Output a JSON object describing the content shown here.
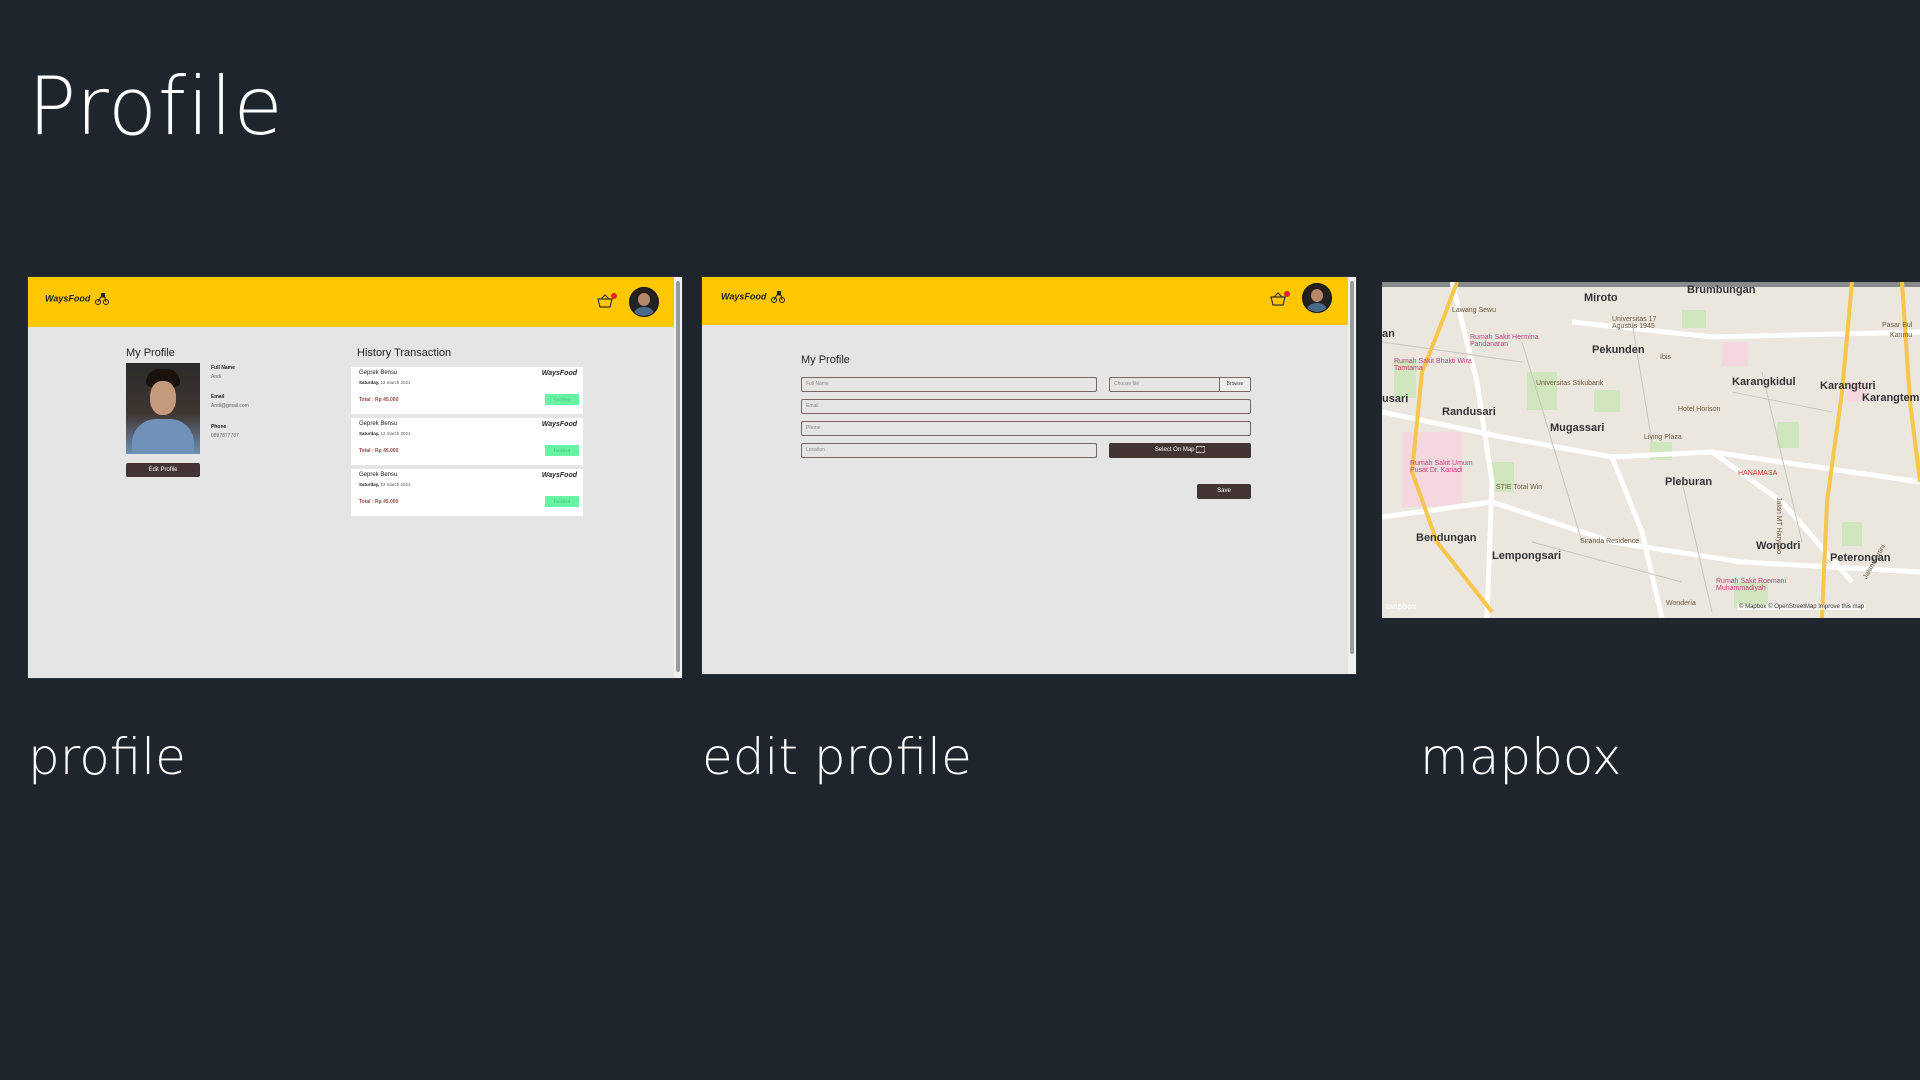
{
  "slide": {
    "title": "Profile"
  },
  "captions": {
    "profile": "profile",
    "edit_profile": "edit profile",
    "mapbox": "mapbox"
  },
  "colors": {
    "background": "#1f252c",
    "navbar": "#ffc700",
    "page": "#e5e5e5",
    "button_dark": "#433434",
    "status_green": "#6af2a4",
    "total_red": "#974a4a"
  },
  "profile_page": {
    "logo": "WaysFood",
    "cart_icon": "basket-icon",
    "my_profile_title": "My Profile",
    "full_name_label": "Full Name",
    "full_name_value": "Andi",
    "email_label": "Email",
    "email_value": "Andi@gmail.com",
    "phone_label": "Phone",
    "phone_value": "0897877787",
    "edit_button": "Edit Profile",
    "history_title": "History Transaction",
    "transactions": [
      {
        "name": "Geprek Bensu",
        "day": "Saturday,",
        "date": "12 march 2021",
        "total": "Total : Rp 45.000",
        "logo": "WaysFood",
        "status": "Finished"
      },
      {
        "name": "Geprek Bensu",
        "day": "Saturday,",
        "date": "12 march 2021",
        "total": "Total : Rp 45.000",
        "logo": "WaysFood",
        "status": "Finished"
      },
      {
        "name": "Geprek Bensu",
        "day": "Saturday,",
        "date": "12 march 2021",
        "total": "Total : Rp 45.000",
        "logo": "WaysFood",
        "status": "Finished"
      }
    ]
  },
  "edit_page": {
    "logo": "WaysFood",
    "title": "My Profile",
    "full_name_placeholder": "Full Name",
    "choose_file": "Choose file",
    "browse": "Browse",
    "email_placeholder": "Email",
    "phone_placeholder": "Phone",
    "location_placeholder": "Location",
    "select_map_button": "Select On Map",
    "save_button": "Save"
  },
  "map": {
    "big_labels": [
      "Brumbungan",
      "Miroto",
      "Pekunden",
      "Randusari",
      "Mugassari",
      "Karangkidul",
      "Karangturi",
      "Karangtempel",
      "Pleburan",
      "Bendungan",
      "Lempongsari",
      "Wonodri",
      "Peterongan",
      "an",
      "usari"
    ],
    "small_labels": [
      "Lawang Sewu",
      "Universitas 17 Agustus 1945",
      "Ibis",
      "Universitas Stikubank",
      "Hotel Horison",
      "Living Plaza",
      "STIE Total Win",
      "Siranda Residence",
      "HANAMASA",
      "Wonderia",
      "Pasar Bul",
      "Karimu",
      "Jalan MT Haryono",
      "Jalan Kartini"
    ],
    "hospital_labels": [
      "Rumah Sakit Hermina Pandanaran",
      "Rumah Sakit Bhakti Wira Tamtama",
      "Rumah Sakit Umum Pusat Dr. Kariadi",
      "Rumah Sakit Roemani Muhammadiyah"
    ],
    "mapbox_logo": "mapbox",
    "attribution": "© Mapbox © OpenStreetMap Improve this map"
  }
}
